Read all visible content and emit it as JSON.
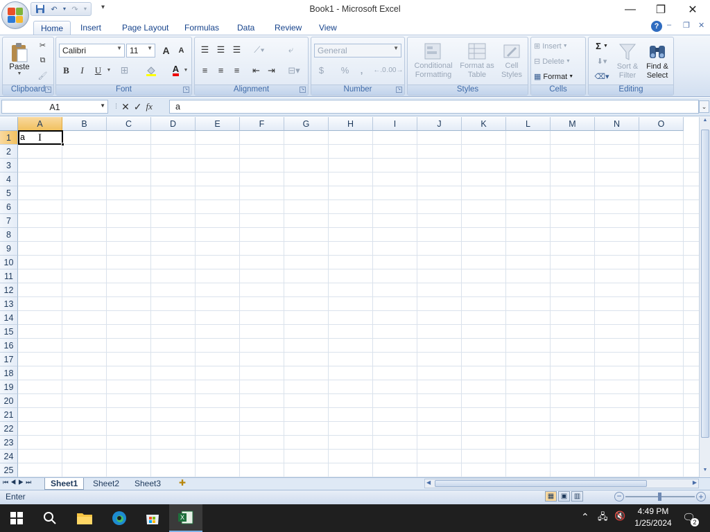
{
  "window": {
    "title": "Book1 - Microsoft Excel"
  },
  "qat": {
    "customize": "▾"
  },
  "tabs": [
    "Home",
    "Insert",
    "Page Layout",
    "Formulas",
    "Data",
    "Review",
    "View"
  ],
  "ribbon": {
    "clipboard": {
      "label": "Clipboard",
      "paste": "Paste"
    },
    "font": {
      "label": "Font",
      "name": "Calibri",
      "size": "11",
      "bold": "B",
      "italic": "I",
      "underline": "U",
      "grow": "A",
      "shrink": "A"
    },
    "alignment": {
      "label": "Alignment"
    },
    "number": {
      "label": "Number",
      "format": "General",
      "currency": "$",
      "percent": "%",
      "comma": ","
    },
    "styles": {
      "label": "Styles",
      "conditional": "Conditional Formatting",
      "format_table": "Format as Table",
      "cell_styles": "Cell Styles"
    },
    "cells": {
      "label": "Cells",
      "insert": "Insert",
      "delete": "Delete",
      "format": "Format"
    },
    "editing": {
      "label": "Editing",
      "sum": "Σ",
      "sort_filter": "Sort & Filter",
      "find_select": "Find & Select"
    }
  },
  "formula_bar": {
    "name_box": "A1",
    "fx": "fx",
    "value": "a"
  },
  "grid": {
    "columns": [
      "A",
      "B",
      "C",
      "D",
      "E",
      "F",
      "G",
      "H",
      "I",
      "J",
      "K",
      "L",
      "M",
      "N",
      "O"
    ],
    "rows": [
      "1",
      "2",
      "3",
      "4",
      "5",
      "6",
      "7",
      "8",
      "9",
      "10",
      "11",
      "12",
      "13",
      "14",
      "15",
      "16",
      "17",
      "18",
      "19",
      "20",
      "21",
      "22",
      "23",
      "24",
      "25"
    ],
    "active_cell": "A1",
    "active_value": "a"
  },
  "sheets": [
    "Sheet1",
    "Sheet2",
    "Sheet3"
  ],
  "status": {
    "mode": "Enter"
  },
  "taskbar": {
    "time": "4:49 PM",
    "date": "1/25/2024",
    "notifications": "2"
  }
}
